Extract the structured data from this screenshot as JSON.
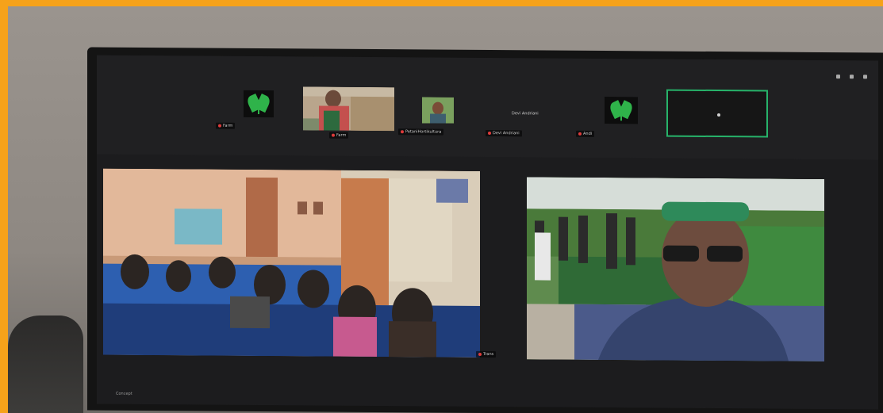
{
  "frame": {
    "border_color": "#f6a21a"
  },
  "gallery": {
    "tiles": [
      {
        "kind": "logo",
        "name": "Farm"
      },
      {
        "kind": "video",
        "name": "Farm"
      },
      {
        "kind": "video",
        "name": "PetaniHortikultura"
      },
      {
        "kind": "text",
        "label": "Devi Andriani",
        "name": "Devi Andriani"
      },
      {
        "kind": "logo",
        "name": "Andi"
      },
      {
        "kind": "active",
        "name": ""
      }
    ]
  },
  "main": {
    "left_label": "",
    "right_label": "Trans"
  },
  "taskbar": {
    "label": "Concept"
  },
  "colors": {
    "logo_green": "#2fb34a",
    "active_border": "#27b36a",
    "mic_muted": "#e03b3b"
  }
}
